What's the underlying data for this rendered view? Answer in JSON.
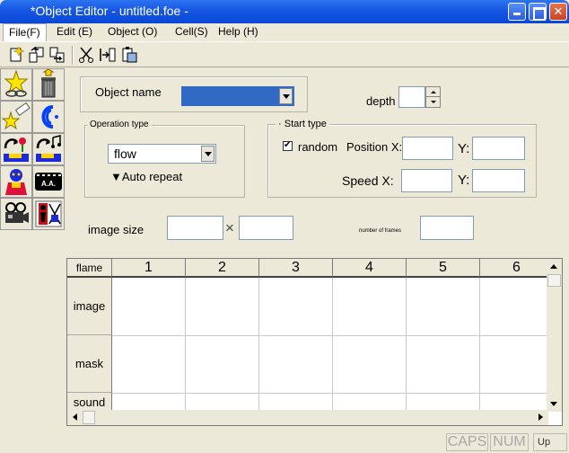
{
  "window": {
    "title": "*Object Editor - untitled.foe -"
  },
  "menu": [
    "File(F)",
    "Edit (E)",
    "Object (O)",
    "Cell(S)",
    "Help (H)"
  ],
  "colors": {
    "title_bar": "#1656e2",
    "selection": "#316ac5",
    "window_bg": "#ece9d8"
  },
  "toolbar_icons": [
    "new-document-icon",
    "import-icon",
    "export-icon",
    "cut-icon",
    "insert-cell-icon",
    "paste-cell-icon"
  ],
  "palette_icons": [
    "star-link-icon",
    "trash-icon",
    "star-eraser-icon",
    "blue-loop-icon",
    "flower-jump-icon",
    "music-jump-icon",
    "character-icon",
    "film-aa-icon",
    "camera-icon",
    "red-figure-icon"
  ],
  "palette_film_label": "A.A.",
  "form": {
    "object_name_label": "Object name",
    "object_name_value": "",
    "depth_label": "depth",
    "depth_value": "",
    "operation_type_label": "Operation type",
    "operation_value": "flow",
    "auto_repeat_label": "▼Auto repeat",
    "start_type_label": "Start type",
    "random_label": "random",
    "random_checked": true,
    "position_x_label": "Position X:",
    "position_y_label": "Y:",
    "position_x_value": "",
    "position_y_value": "",
    "speed_x_label": "Speed X:",
    "speed_y_label": "Y:",
    "speed_x_value": "",
    "speed_y_value": "",
    "image_size_label": "image size",
    "size_separator": "×",
    "image_width_value": "",
    "image_height_value": "",
    "frames_label": "number of frames",
    "frames_value": ""
  },
  "grid": {
    "corner_label": "flame",
    "columns": [
      "1",
      "2",
      "3",
      "4",
      "5",
      "6"
    ],
    "rows": [
      "image",
      "mask",
      "sound"
    ]
  },
  "status": {
    "caps": "CAPS",
    "num": "NUM",
    "up": "Up"
  }
}
